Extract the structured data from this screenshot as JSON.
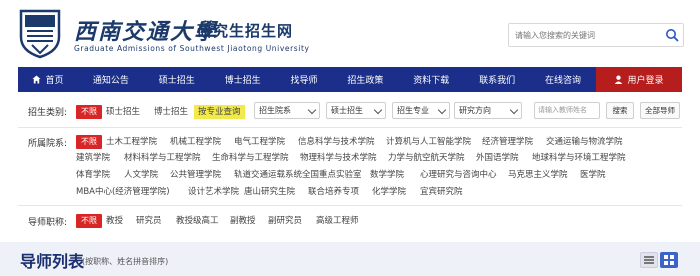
{
  "header": {
    "university_name": "西南交通大學",
    "site_name": "研究生招生网",
    "english_name": "Graduate Admissions of Southwest Jiaotong University",
    "search_placeholder": "请输入您搜索的关键词"
  },
  "nav": {
    "items": [
      {
        "label": "首页",
        "icon": "home-icon"
      },
      {
        "label": "通知公告"
      },
      {
        "label": "硕士招生"
      },
      {
        "label": "博士招生"
      },
      {
        "label": "找导师"
      },
      {
        "label": "招生政策"
      },
      {
        "label": "资料下载"
      },
      {
        "label": "联系我们"
      },
      {
        "label": "在线咨询"
      }
    ],
    "login": {
      "label": "用户登录",
      "icon": "user-icon"
    },
    "colors": {
      "bar": "#1a2e8a",
      "login": "#b61e1e"
    }
  },
  "filters": {
    "category": {
      "label": "招生类别:",
      "active": "不限",
      "options": [
        "硕士招生",
        "博士招生",
        "按专业查询"
      ],
      "highlighted": "按专业查询",
      "selects": [
        "招生院系",
        "硕士招生",
        "招生专业",
        "研究方向"
      ],
      "teacher_placeholder": "请输入教师姓名",
      "search_button": "搜索",
      "all_teachers_button": "全部导师"
    },
    "department": {
      "label": "所属院系:",
      "active": "不限",
      "options": [
        "土木工程学院",
        "机械工程学院",
        "电气工程学院",
        "信息科学与技术学院",
        "计算机与人工智能学院",
        "经济管理学院",
        "交通运输与物流学院",
        "建筑学院",
        "材料科学与工程学院",
        "生命科学与工程学院",
        "物理科学与技术学院",
        "力学与航空航天学院",
        "外国语学院",
        "地球科学与环境工程学院",
        "体育学院",
        "人文学院",
        "公共管理学院",
        "轨道交通运载系统全国重点实验室",
        "数学学院",
        "心理研究与咨询中心",
        "马克思主义学院",
        "医学院",
        "MBA中心(经济管理学院)",
        "设计艺术学院",
        "唐山研究生院",
        "联合培养专项",
        "化学学院",
        "宜宾研究院"
      ]
    },
    "title": {
      "label": "导师职称:",
      "active": "不限",
      "options": [
        "教授",
        "研究员",
        "教授级高工",
        "副教授",
        "副研究员",
        "高级工程师"
      ]
    },
    "colors": {
      "active_tag": "#d82626",
      "highlight": "#f2e94a"
    }
  },
  "list": {
    "title": "导师列表",
    "subtitle": "(按职称、姓名拼音排序)",
    "views": [
      "list-view-icon",
      "grid-view-icon"
    ]
  }
}
